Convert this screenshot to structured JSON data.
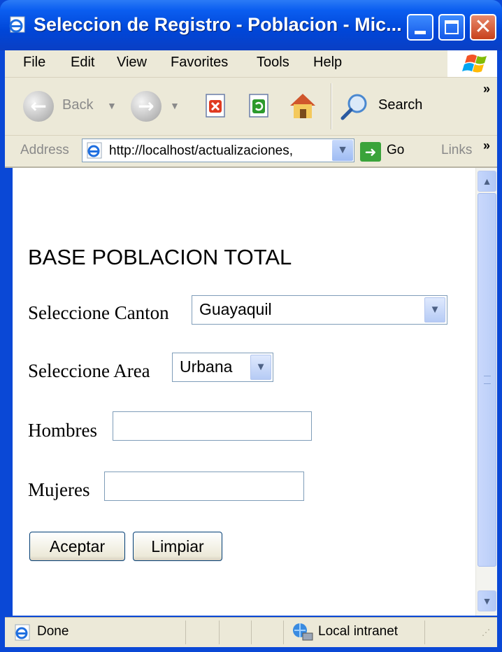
{
  "window": {
    "title": "Seleccion de Registro - Poblacion - Mic..."
  },
  "menu": {
    "items": [
      "File",
      "Edit",
      "View",
      "Favorites",
      "Tools",
      "Help"
    ]
  },
  "toolbar": {
    "back_label": "Back",
    "search_label": "Search"
  },
  "address": {
    "label": "Address",
    "url": "http://localhost/actualizaciones,",
    "go_label": "Go",
    "links_label": "Links"
  },
  "page": {
    "heading": "BASE POBLACION TOTAL",
    "canton_label": "Seleccione Canton",
    "canton_value": "Guayaquil",
    "area_label": "Seleccione Area",
    "area_value": "Urbana",
    "hombres_label": "Hombres",
    "hombres_value": "",
    "mujeres_label": "Mujeres",
    "mujeres_value": "",
    "accept_label": "Aceptar",
    "clear_label": "Limpiar"
  },
  "status": {
    "text": "Done",
    "zone": "Local intranet"
  }
}
